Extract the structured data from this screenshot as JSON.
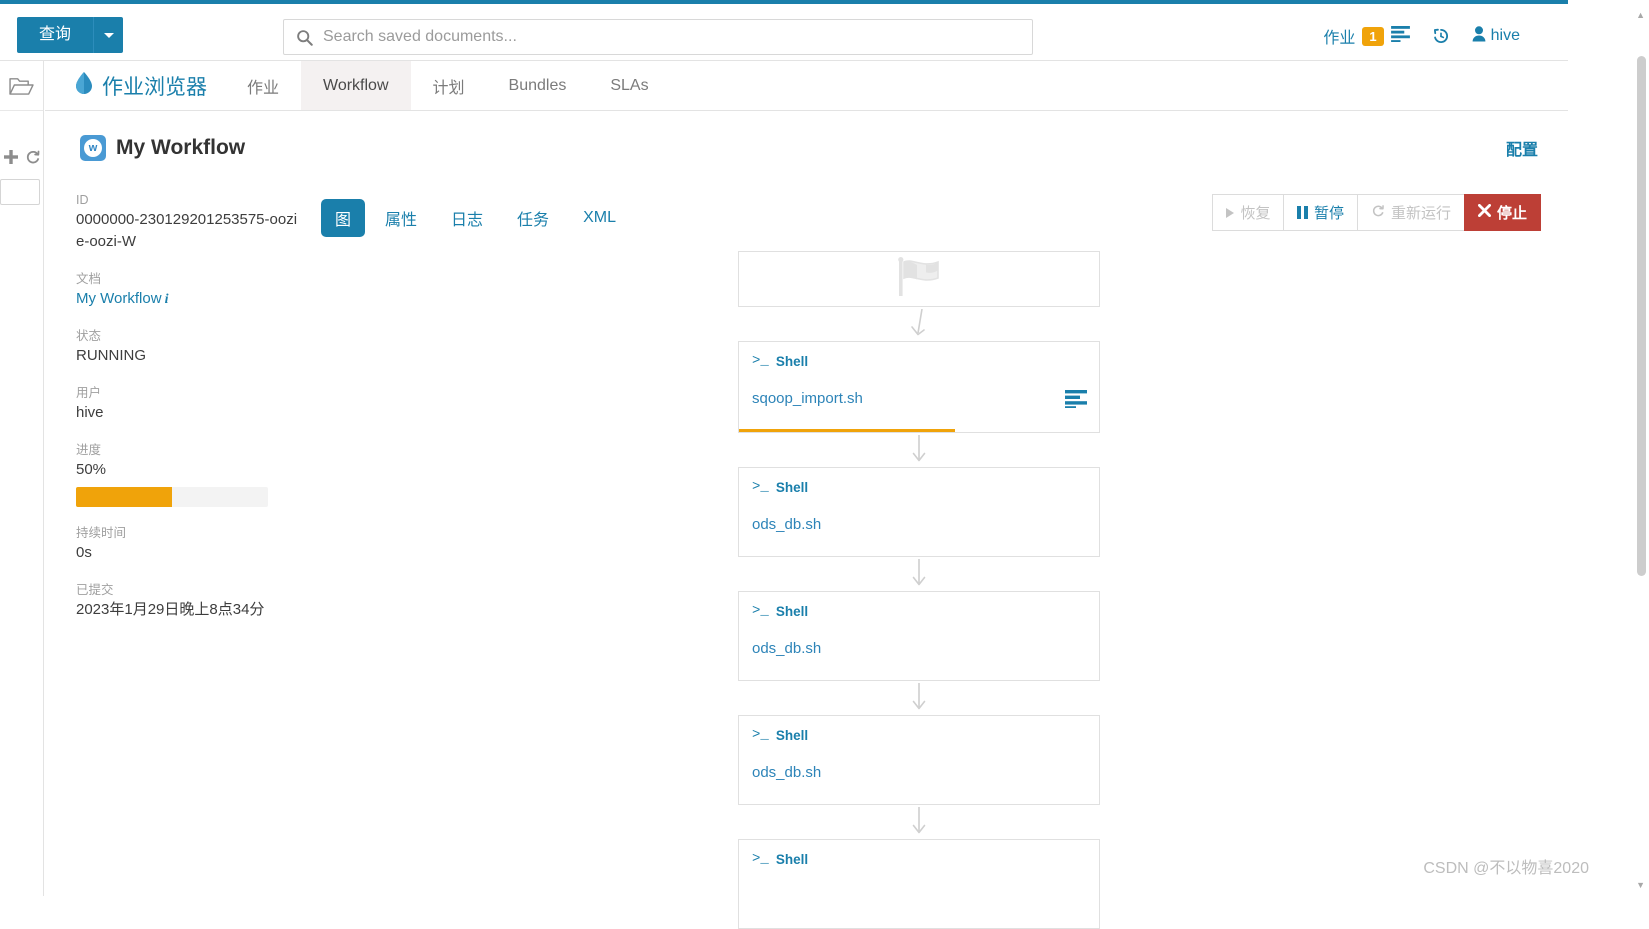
{
  "header": {
    "query_button": "查询",
    "search_placeholder": "Search saved documents...",
    "search_value": "",
    "jobs_label": "作业",
    "jobs_badge": "1",
    "jobs_list_icon": "list-icon",
    "history_icon": "history-icon",
    "user_icon": "user-icon",
    "user_name": "hive",
    "accent_color": "#1a7fab"
  },
  "left_rail": {
    "folder_icon": "folder-icon",
    "add_icon": "plus-icon",
    "refresh_icon": "refresh-icon",
    "filter_value": ""
  },
  "app_nav": {
    "brand_icon": "hue-drop-icon",
    "brand": "作业浏览器",
    "tabs": [
      {
        "label": "作业",
        "active": false
      },
      {
        "label": "Workflow",
        "active": true
      },
      {
        "label": "计划",
        "active": false
      },
      {
        "label": "Bundles",
        "active": false
      },
      {
        "label": "SLAs",
        "active": false
      }
    ]
  },
  "workflow": {
    "icon": "workflow-w-icon",
    "title": "My Workflow",
    "config_label": "配置"
  },
  "details": {
    "id_label": "ID",
    "id_value": "0000000-230129201253575-oozie-oozi-W",
    "doc_label": "文档",
    "doc_value": "My Workflow",
    "doc_info_icon": "info-icon",
    "status_label": "状态",
    "status_value": "RUNNING",
    "user_label": "用户",
    "user_value": "hive",
    "progress_label": "进度",
    "progress_value": "50%",
    "progress_percent": 50,
    "progress_color": "#f0a30a",
    "duration_label": "持续时间",
    "duration_value": "0s",
    "submitted_label": "已提交",
    "submitted_value": "2023年1月29日晚上8点34分"
  },
  "view_tabs": [
    {
      "label": "图",
      "active": true
    },
    {
      "label": "属性",
      "active": false
    },
    {
      "label": "日志",
      "active": false
    },
    {
      "label": "任务",
      "active": false
    },
    {
      "label": "XML",
      "active": false
    }
  ],
  "actions": [
    {
      "label": "恢复",
      "icon": "play-icon",
      "state": "disabled"
    },
    {
      "label": "暂停",
      "icon": "pause-icon",
      "state": "enabled"
    },
    {
      "label": "重新运行",
      "icon": "rerun-icon",
      "state": "disabled"
    },
    {
      "label": "停止",
      "icon": "close-icon",
      "state": "danger"
    }
  ],
  "graph": {
    "nodes": [
      {
        "kind": "start",
        "icon": "checkered-flag-icon",
        "type": "",
        "name": "",
        "progress": 0
      },
      {
        "kind": "shell",
        "icon": "shell-prompt-icon",
        "type": "Shell",
        "name": "sqoop_import.sh",
        "progress": 60,
        "side_icon": "logs-icon"
      },
      {
        "kind": "shell",
        "icon": "shell-prompt-icon",
        "type": "Shell",
        "name": "ods_db.sh",
        "progress": 0
      },
      {
        "kind": "shell",
        "icon": "shell-prompt-icon",
        "type": "Shell",
        "name": "ods_db.sh",
        "progress": 0
      },
      {
        "kind": "shell",
        "icon": "shell-prompt-icon",
        "type": "Shell",
        "name": "ods_db.sh",
        "progress": 0
      },
      {
        "kind": "shell",
        "icon": "shell-prompt-icon",
        "type": "Shell",
        "name": "",
        "progress": 0
      }
    ]
  },
  "watermark": "CSDN @不以物喜2020"
}
